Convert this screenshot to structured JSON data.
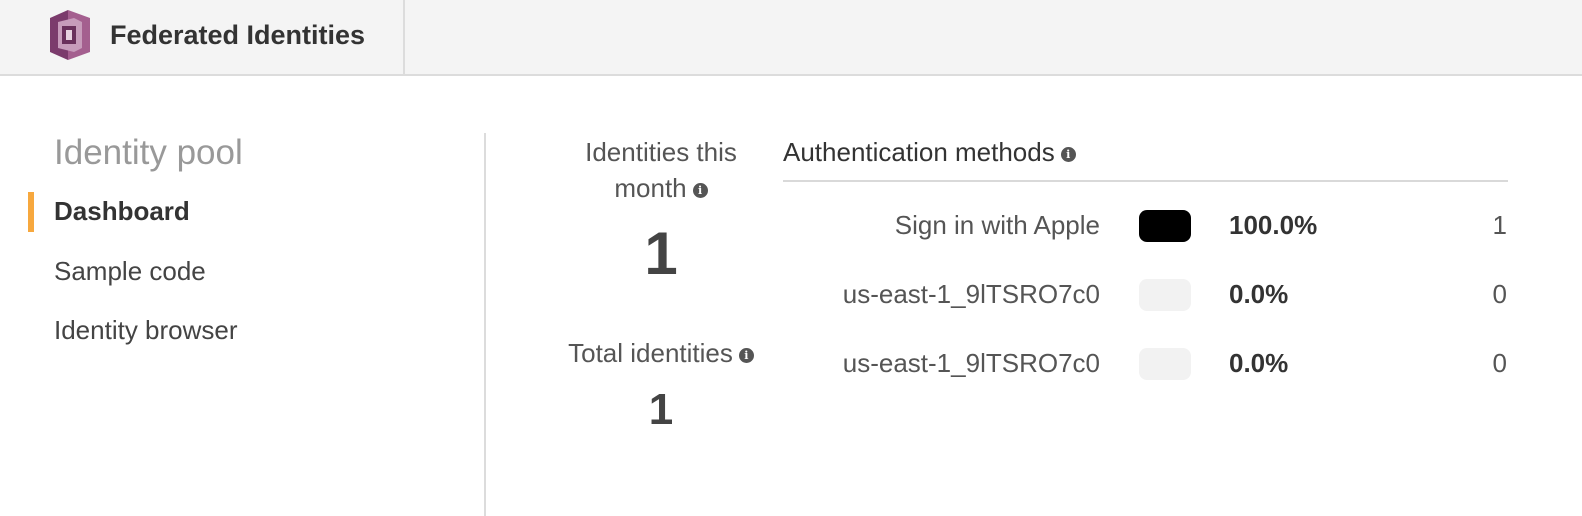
{
  "header": {
    "logo_icon": "cognito-logo-icon",
    "title": "Federated Identities"
  },
  "sidebar": {
    "title": "Identity pool",
    "items": [
      {
        "label": "Dashboard",
        "active": true
      },
      {
        "label": "Sample code",
        "active": false
      },
      {
        "label": "Identity browser",
        "active": false
      }
    ],
    "active_color": "#f7a83e"
  },
  "stats": {
    "month": {
      "label_line1": "Identities this",
      "label_line2": "month",
      "value": "1"
    },
    "total": {
      "label": "Total identities",
      "value": "1"
    },
    "info_icon": "i"
  },
  "auth": {
    "title": "Authentication methods",
    "rows": [
      {
        "name": "Sign in with Apple",
        "percent": "100.0%",
        "count": "1",
        "color": "#000000"
      },
      {
        "name": "us-east-1_9lTSRO7c0",
        "percent": "0.0%",
        "count": "0",
        "color": "#f2f2f2"
      },
      {
        "name": "us-east-1_9lTSRO7c0",
        "percent": "0.0%",
        "count": "0",
        "color": "#f2f2f2"
      }
    ]
  }
}
